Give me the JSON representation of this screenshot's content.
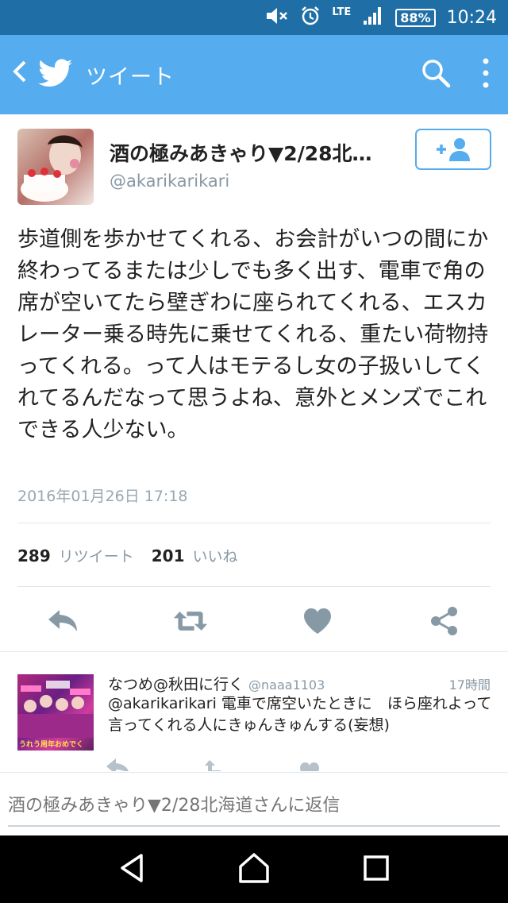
{
  "statusbar": {
    "network": "LTE",
    "battery": "88%",
    "time": "10:24"
  },
  "appbar": {
    "title": "ツイート"
  },
  "tweet": {
    "name": "酒の極みあきゃり▼2/28北…",
    "handle": "@akarikarikari",
    "text": "歩道側を歩かせてくれる、お会計がいつの間にか終わってるまたは少しでも多く出す、電車で角の席が空いてたら壁ぎわに座られてくれる、エスカレーター乗る時先に乗せてくれる、重たい荷物持ってくれる。って人はモテるし女の子扱いしてくれてるんだなって思うよね、意外とメンズでこれできる人少ない。",
    "date": "2016年01月26日 17:18",
    "retweets_count": "289",
    "retweets_label": "リツイート",
    "likes_count": "201",
    "likes_label": "いいね"
  },
  "reply": {
    "name": "なつめ@秋田に行く",
    "handle": "@naaa1103",
    "time": "17時間",
    "text": "@akarikarikari 電車で席空いたときに　ほら座れよって言ってくれる人にきゅんきゅんする(妄想)",
    "avatar_caption": "うれう周年おめでく"
  },
  "compose": {
    "placeholder": "酒の極みあきゃり▼2/28北海道さんに返信"
  },
  "colors": {
    "accent": "#55acee",
    "statusbar": "#1f6fa6",
    "icon": "#8899a6"
  }
}
